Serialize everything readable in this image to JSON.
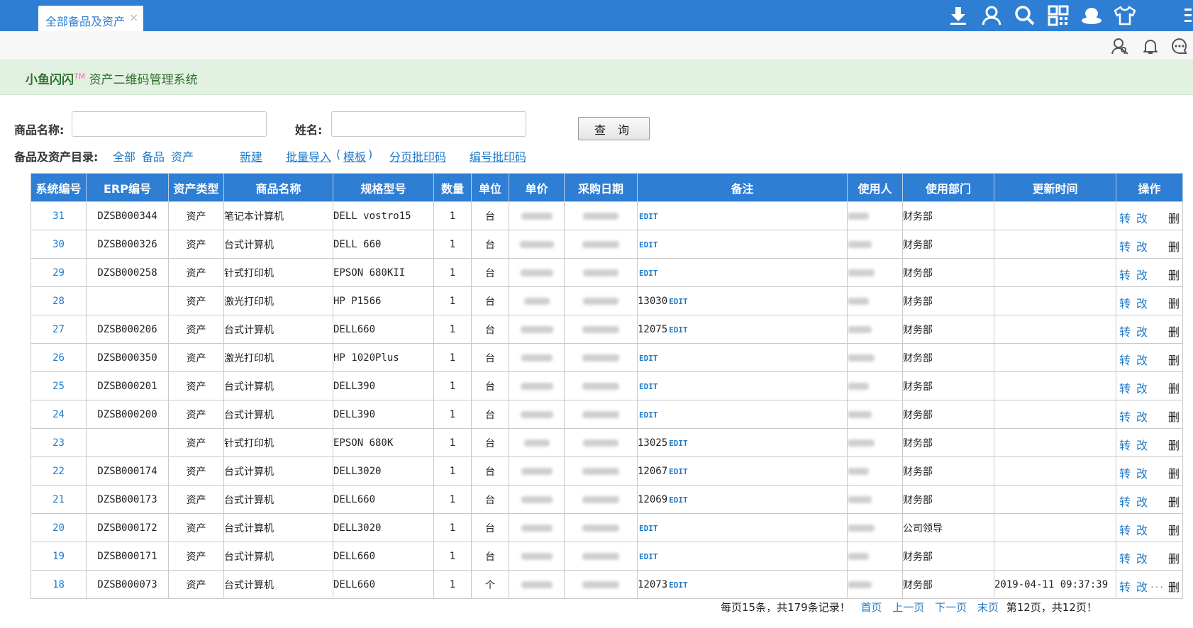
{
  "tab": {
    "label": "全部备品及资产",
    "close": "×"
  },
  "top_icons": [
    "download-icon",
    "user-icon",
    "search-icon",
    "apps-icon",
    "hat-icon",
    "shirt-icon",
    "menu-icon"
  ],
  "sub_icons": [
    "contacts-icon",
    "bell-icon",
    "chat-icon"
  ],
  "brand": {
    "name": "小鱼闪闪",
    "tm": "TM",
    "system": " 资产二维码管理系统"
  },
  "search": {
    "product_label": "商品名称:",
    "product_value": "",
    "person_label": "姓名:",
    "person_value": "",
    "query_button": "查 询"
  },
  "catalog": {
    "label": "备品及资产目录:",
    "all": "全部",
    "spare": "备品",
    "asset": "资产",
    "create": "新建",
    "batch_import": "批量导入",
    "template": "模板",
    "paren_open": "(",
    "paren_close": ")",
    "page_print": "分页批印码",
    "code_print": "编号批印码"
  },
  "table": {
    "columns": [
      "系统编号",
      "ERP编号",
      "资产类型",
      "商品名称",
      "规格型号",
      "数量",
      "单位",
      "单价",
      "采购日期",
      "备注",
      "使用人",
      "使用部门",
      "更新时间",
      "操作"
    ],
    "edit_label": "EDIT",
    "op_transfer": "转",
    "op_edit": "改",
    "op_delete": "删",
    "more": "...",
    "rows": [
      {
        "id": "31",
        "erp": "DZSB000344",
        "type": "资产",
        "name": "笔记本计算机",
        "model": "DELL vostro15",
        "qty": "1",
        "unit": "台",
        "note": "",
        "dept": "财务部",
        "updated": ""
      },
      {
        "id": "30",
        "erp": "DZSB000326",
        "type": "资产",
        "name": "台式计算机",
        "model": "DELL 660",
        "qty": "1",
        "unit": "台",
        "note": "",
        "dept": "财务部",
        "updated": ""
      },
      {
        "id": "29",
        "erp": "DZSB000258",
        "type": "资产",
        "name": "针式打印机",
        "model": "EPSON 680KII",
        "qty": "1",
        "unit": "台",
        "note": "",
        "dept": "财务部",
        "updated": ""
      },
      {
        "id": "28",
        "erp": "",
        "type": "资产",
        "name": "激光打印机",
        "model": "HP P1566",
        "qty": "1",
        "unit": "台",
        "note": "13030",
        "dept": "财务部",
        "updated": ""
      },
      {
        "id": "27",
        "erp": "DZSB000206",
        "type": "资产",
        "name": "台式计算机",
        "model": "DELL660",
        "qty": "1",
        "unit": "台",
        "note": "12075",
        "dept": "财务部",
        "updated": ""
      },
      {
        "id": "26",
        "erp": "DZSB000350",
        "type": "资产",
        "name": "激光打印机",
        "model": "HP 1020Plus",
        "qty": "1",
        "unit": "台",
        "note": "",
        "dept": "财务部",
        "updated": ""
      },
      {
        "id": "25",
        "erp": "DZSB000201",
        "type": "资产",
        "name": "台式计算机",
        "model": "DELL390",
        "qty": "1",
        "unit": "台",
        "note": "",
        "dept": "财务部",
        "updated": ""
      },
      {
        "id": "24",
        "erp": "DZSB000200",
        "type": "资产",
        "name": "台式计算机",
        "model": "DELL390",
        "qty": "1",
        "unit": "台",
        "note": "",
        "dept": "财务部",
        "updated": ""
      },
      {
        "id": "23",
        "erp": "",
        "type": "资产",
        "name": "针式打印机",
        "model": "EPSON 680K",
        "qty": "1",
        "unit": "台",
        "note": "13025",
        "dept": "财务部",
        "updated": ""
      },
      {
        "id": "22",
        "erp": "DZSB000174",
        "type": "资产",
        "name": "台式计算机",
        "model": "DELL3020",
        "qty": "1",
        "unit": "台",
        "note": "12067",
        "dept": "财务部",
        "updated": ""
      },
      {
        "id": "21",
        "erp": "DZSB000173",
        "type": "资产",
        "name": "台式计算机",
        "model": "DELL660",
        "qty": "1",
        "unit": "台",
        "note": "12069",
        "dept": "财务部",
        "updated": ""
      },
      {
        "id": "20",
        "erp": "DZSB000172",
        "type": "资产",
        "name": "台式计算机",
        "model": "DELL3020",
        "qty": "1",
        "unit": "台",
        "note": "",
        "dept": "公司领导",
        "updated": ""
      },
      {
        "id": "19",
        "erp": "DZSB000171",
        "type": "资产",
        "name": "台式计算机",
        "model": "DELL660",
        "qty": "1",
        "unit": "台",
        "note": "",
        "dept": "财务部",
        "updated": ""
      },
      {
        "id": "18",
        "erp": "DZSB000073",
        "type": "资产",
        "name": "台式计算机",
        "model": "DELL660",
        "qty": "1",
        "unit": "个",
        "note": "12073",
        "dept": "财务部",
        "updated": "2019-04-11 09:37:39"
      }
    ]
  },
  "pager": {
    "summary": "每页15条，共179条记录！",
    "first": "首页",
    "prev": "上一页",
    "next": "下一页",
    "last": "末页",
    "status": "第12页，共12页！"
  }
}
